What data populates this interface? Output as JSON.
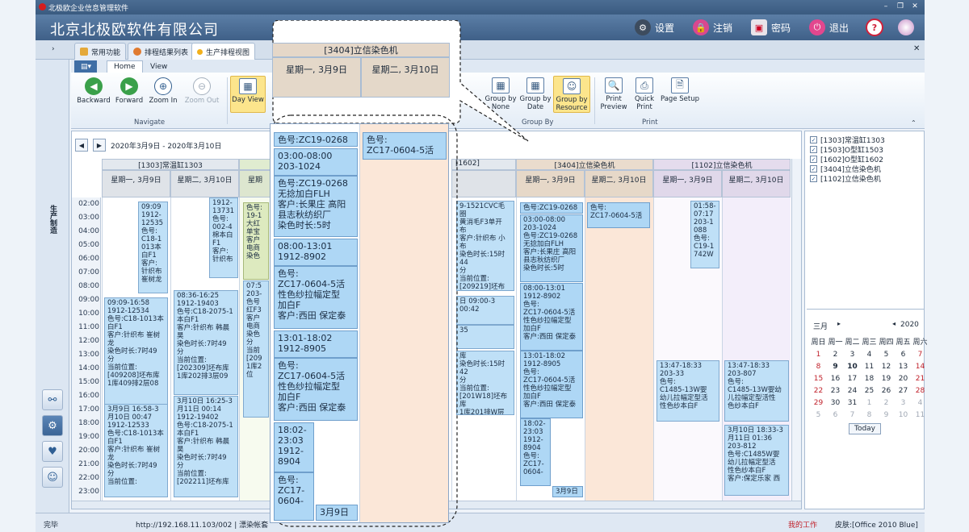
{
  "window": {
    "title": "北极欧企业信息管理软件"
  },
  "brand": {
    "name": "北京北极欧软件有限公司",
    "settings": "设置",
    "logout": "注销",
    "password": "密码",
    "exit": "退出",
    "help": "?"
  },
  "tabs": [
    {
      "label": "常用功能"
    },
    {
      "label": "排程结果列表"
    },
    {
      "label": "生产排程视图"
    }
  ],
  "leftnav": {
    "vertical_label": "生产制造"
  },
  "ribbon": {
    "tabs": [
      "Home",
      "View"
    ],
    "buttons": {
      "backward": "Backward",
      "forward": "Forward",
      "zoom_in": "Zoom In",
      "zoom_out": "Zoom Out",
      "day_view": "Day View",
      "group_none": "Group by None",
      "group_date": "Group by Date",
      "group_resource": "Group by Resource",
      "print_preview": "Print Preview",
      "quick_print": "Quick Print",
      "page_setup": "Page Setup"
    },
    "groups": {
      "navigate": "Navigate",
      "group_by": "Group By",
      "print": "Print"
    }
  },
  "calendar": {
    "date_range": "2020年3月9日 - 2020年3月10日",
    "times": [
      "02:00",
      "03:00",
      "04:00",
      "05:00",
      "06:00",
      "07:00",
      "08:00",
      "09:00",
      "10:00",
      "11:00",
      "12:00",
      "13:00",
      "14:00",
      "15:00",
      "16:00",
      "17:00",
      "18:00",
      "19:00",
      "20:00",
      "21:00",
      "22:00",
      "23:00"
    ],
    "resources": [
      "[1303]常温缸1303",
      "[1602]",
      "[3404]立信染色机",
      "[1102]立信染色机"
    ],
    "days": [
      "星期一, 3月9日",
      "星期二, 3月10日"
    ],
    "appts": {
      "a1": "09:09\n1912-\n12535\n色号:\nC18-1\n013本\n白F1\n客户:\n针织布\n崔树龙",
      "a2": "09:09-16:58\n1912-12534\n色号:C18-1013本\n白F1\n客户:针织布 崔树\n龙\n染色时长:7时49\n分\n当前位置:\n[409208]坯布库\n1库409排2层08",
      "a3": "3月9日 16:58-3\n月10日 00:47\n1912-12533\n色号:C18-1013本\n白F1\n客户:针织布 崔树\n龙\n染色时长:7时49\n分\n当前位置:",
      "a4": "1912-\n13731\n色号:\n002-4\n棉本白\nF1\n客户:\n针织布",
      "a5": "08:36-16:25\n1912-19403\n色号:C18-2075-1\n本白F1\n客户:针织布 韩晨\n昊\n染色时长:7时49\n分\n当前位置:\n[202309]坯布库\n1库202排3层09",
      "a6": "3月10日 16:25-3\n月11日 00:14\n1912-19402\n色号:C18-2075-1\n本白F1\n客户:针织布 韩晨\n昊\n染色时长:7时49\n分\n当前位置:\n[202211]坯布库",
      "a7": "色号:\n19-1\n大红\n单宝\n客户\n电商\n染色",
      "a8": "07:5\n203-\n色号\n红F3\n客户\n电商\n染色\n分\n当前\n[209\n1库2\n位",
      "a9": "9-1521CVC毛圈\n黄消毛F3单开\n布\n客户:针织布 小布\n染色时长:15时44\n分\n当前位置:\n[209219]坯布库",
      "a10": "日 09:00-3\n00:42",
      "a11": "35",
      "a12": "库\n染色时长:15时42\n分\n当前位置:\n[201W18]坯布库\n1库201排W层\n位",
      "a13": "色号:ZC19-0268",
      "a14": "03:00-08:00\n203-1024\n色号:ZC19-0268\n无捻加白FLH\n客户:长果庄 高阳\n县志秋纺织厂\n染色时长:5时",
      "a15": "08:00-13:01\n1912-8902\n色号:\nZC17-0604-5活\n性色纱拉幅定型\n加白F\n客户:西田 保定泰",
      "a16": "13:01-18:02\n1912-8905\n色号:\nZC17-0604-5活\n性色纱拉幅定型\n加白F\n客户:西田 保定泰",
      "a17": "18:02-\n23:03\n1912-\n8904\n色号:\nZC17-\n0604-",
      "a18": "3月9日",
      "a19": "色号:\nZC17-0604-5活",
      "a20": "01:58-\n07:17\n203-1\n088\n色号:\nC19-1\n742W",
      "a21": "13:47-18:33\n203-33\n色号:\nC1485-13W婴\n幼儿拉幅定型活\n性色纱本白F",
      "a22": "13:47-18:33\n203-807\n色号:\nC1485-13W婴幼\n儿拉幅定型活性\n色纱本白F",
      "a23": "3月10日 18:33-3\n月11日 01:36\n203-812\n色号:C1485W婴\n幼儿拉幅定型活\n性色纱本白F\n客户:保定乐家 西"
    }
  },
  "callout": {
    "resource": "[3404]立信染色机",
    "day1": "星期一, 3月9日",
    "day2": "星期二, 3月10日",
    "a1": "色号:ZC19-0268",
    "a2": "03:00-08:00\n203-1024",
    "a3": "色号:ZC19-0268\n无捻加白FLH\n客户:长果庄 高阳\n县志秋纺织厂\n染色时长:5时",
    "a4": "08:00-13:01\n1912-8902",
    "a5": "色号:\nZC17-0604-5活\n性色纱拉幅定型\n加白F\n客户:西田 保定泰",
    "a6": "13:01-18:02\n1912-8905",
    "a7": "色号:\nZC17-0604-5活\n性色纱拉幅定型\n加白F\n客户:西田 保定泰",
    "a8": "18:02-\n23:03\n1912-\n8904",
    "a9": "色号:\nZC17-\n0604-",
    "a10": "3月9日",
    "a11": "色号:\nZC17-0604-5活"
  },
  "resource_list": [
    "[1303]常温缸1303",
    "[1503]O型缸1503",
    "[1602]O型缸1602",
    "[3404]立信染色机",
    "[1102]立信染色机"
  ],
  "minical": {
    "month": "三月",
    "year": "2020",
    "weekdays": [
      "周日",
      "周一",
      "周二",
      "周三",
      "周四",
      "周五",
      "周六"
    ],
    "weeks": [
      [
        "1",
        "2",
        "3",
        "4",
        "5",
        "6",
        "7"
      ],
      [
        "8",
        "9",
        "10",
        "11",
        "12",
        "13",
        "14"
      ],
      [
        "15",
        "16",
        "17",
        "18",
        "19",
        "20",
        "21"
      ],
      [
        "22",
        "23",
        "24",
        "25",
        "26",
        "27",
        "28"
      ],
      [
        "29",
        "30",
        "31",
        "1",
        "2",
        "3",
        "4"
      ],
      [
        "5",
        "6",
        "7",
        "8",
        "9",
        "10",
        "11"
      ]
    ],
    "today": "Today"
  },
  "status": {
    "left": "完毕",
    "url": "http://192.168.11.103/002 | 漂染帐套",
    "my_work": "我的工作",
    "skin": "皮肤:[Office 2010 Blue]"
  }
}
